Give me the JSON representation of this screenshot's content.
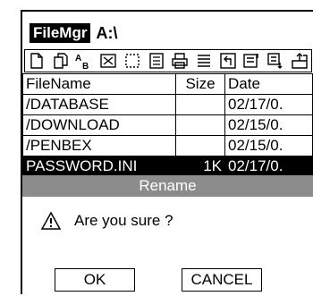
{
  "window": {
    "app_name": "FileMgr",
    "path": "A:\\"
  },
  "toolbar": {
    "icons": [
      "new-file-icon",
      "copy-icon",
      "rename-icon",
      "delete-icon",
      "select-icon",
      "properties-icon",
      "print-icon",
      "list-view-icon",
      "up-folder-icon",
      "details-view-icon",
      "sort-icon",
      "open-icon"
    ]
  },
  "table": {
    "headers": {
      "name": "FileName",
      "size": "Size",
      "date": "Date"
    },
    "rows": [
      {
        "name": "/DATABASE",
        "size": "",
        "date": "02/17/0."
      },
      {
        "name": "/DOWNLOAD",
        "size": "",
        "date": "02/15/0."
      },
      {
        "name": "/PENBEX",
        "size": "",
        "date": "02/15/0."
      },
      {
        "name": "PASSWORD.INI",
        "size": "1K",
        "date": "02/17/0."
      }
    ]
  },
  "dialog": {
    "title": "Rename",
    "message": "Are you sure ?",
    "ok_label": "OK",
    "cancel_label": "CANCEL"
  }
}
